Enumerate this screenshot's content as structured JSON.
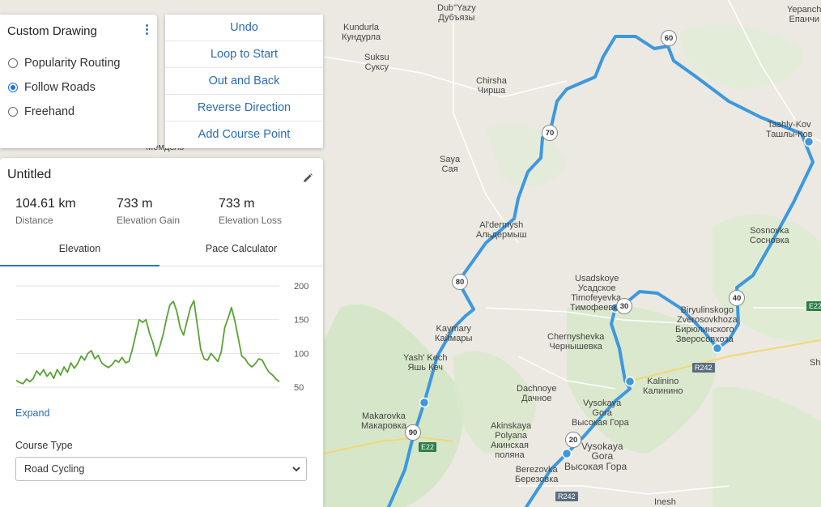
{
  "mode": {
    "title": "Custom Drawing",
    "options": [
      "Popularity Routing",
      "Follow Roads",
      "Freehand"
    ],
    "selected": "Follow Roads"
  },
  "actions": [
    "Undo",
    "Loop to Start",
    "Out and Back",
    "Reverse Direction",
    "Add Course Point"
  ],
  "route": {
    "title": "Untitled",
    "stats": [
      {
        "value": "104.61 km",
        "label": "Distance"
      },
      {
        "value": "733 m",
        "label": "Elevation Gain"
      },
      {
        "value": "733 m",
        "label": "Elevation Loss"
      }
    ],
    "tabs": [
      "Elevation",
      "Pace Calculator"
    ],
    "active_tab": "Elevation",
    "expand": "Expand",
    "course_type_label": "Course Type",
    "course_type_value": "Road Cycling"
  },
  "chart_data": {
    "type": "line",
    "ylim": [
      50,
      200
    ],
    "yticks": [
      200,
      150,
      100,
      50
    ],
    "series": [
      {
        "values": [
          60,
          57,
          55,
          62,
          58,
          63,
          74,
          68,
          76,
          66,
          72,
          63,
          76,
          68,
          80,
          72,
          86,
          78,
          85,
          96,
          90,
          100,
          104,
          92,
          97,
          86,
          82,
          79,
          83,
          90,
          87,
          94,
          86,
          88,
          106,
          128,
          150,
          146,
          150,
          130,
          116,
          96,
          110,
          128,
          152,
          172,
          177,
          162,
          138,
          127,
          148,
          168,
          178,
          142,
          106,
          92,
          90,
          100,
          94,
          88,
          102,
          138,
          152,
          168,
          148,
          122,
          96,
          92,
          84,
          80,
          85,
          92,
          90,
          80,
          72,
          68,
          62,
          58
        ]
      }
    ],
    "color": "#57a332"
  },
  "map_labels": [
    {
      "l1": "Dub\"Yazy",
      "l2": "Дубъязы"
    },
    {
      "l1": "Kundurla",
      "l2": "Кундурла"
    },
    {
      "l1": "Suksu",
      "l2": "Суксу"
    },
    {
      "l1": "Chirsha",
      "l2": "Чирша"
    },
    {
      "l1": "Saya",
      "l2": "Сая"
    },
    {
      "l1": "Al'dermysh",
      "l2": "Альдермыш"
    },
    {
      "l1": "Usadskoye",
      "l2": "Усадское"
    },
    {
      "l1": "Timofeyevka",
      "l2": "Тимофеевка"
    },
    {
      "l1": "Kaymary",
      "l2": "Каймары"
    },
    {
      "l1": "Yash' Kech",
      "l2": "Яшь Кеч"
    },
    {
      "l1": "Chernyshevka",
      "l2": "Чернышевка"
    },
    {
      "l1": "Dachnoye",
      "l2": "Дачное"
    },
    {
      "l1": "Kalinino",
      "l2": "Калинино"
    },
    {
      "l1": "Vysokaya",
      "l2": "Gora"
    },
    {
      "l1": "Высокая Гора",
      "l2": ""
    },
    {
      "l1": "Vysokaya",
      "l2": "Gora"
    },
    {
      "l1": "Высокая Гора",
      "l2": ""
    },
    {
      "l1": "Akinskaya",
      "l2": "Polyana"
    },
    {
      "l1": "Акинская",
      "l2": "поляна"
    },
    {
      "l1": "Makarovka",
      "l2": "Макаровка"
    },
    {
      "l1": "Berezovka",
      "l2": "Березовка"
    },
    {
      "l1": "Biryulinskogo",
      "l2": "Zverosovkhoza"
    },
    {
      "l1": "Бирюлинского",
      "l2": "Зверосовхоза"
    },
    {
      "l1": "Sosnovka",
      "l2": "Сосновка"
    },
    {
      "l1": "Tashly-Kov",
      "l2": "Ташлы-Ков"
    },
    {
      "l1": "Yepanch",
      "l2": "Епанчи"
    },
    {
      "l1": "Inesh",
      "l2": ""
    },
    {
      "l1": "Sha",
      "l2": ""
    },
    {
      "l1": "Мемдель",
      "l2": ""
    }
  ],
  "shields": [
    "60",
    "70",
    "80",
    "90",
    "20",
    "30",
    "40"
  ],
  "roads": [
    "E22",
    "E22",
    "R242",
    "R242"
  ]
}
